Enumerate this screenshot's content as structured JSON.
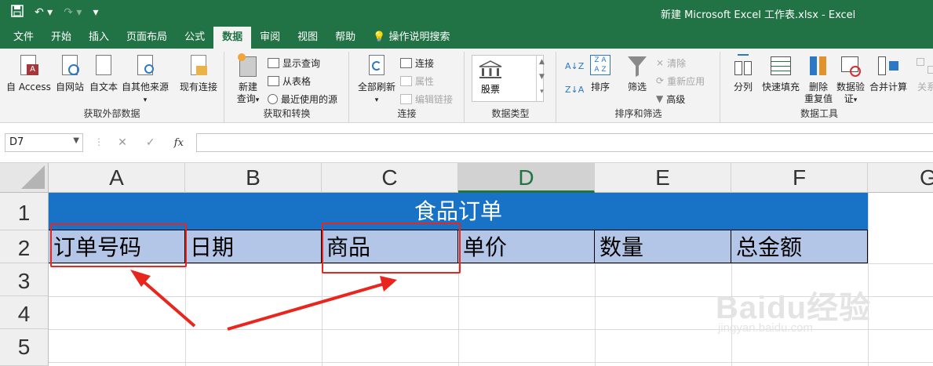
{
  "window": {
    "title": "新建 Microsoft Excel 工作表.xlsx  -  Excel"
  },
  "tabs": [
    {
      "label": "文件"
    },
    {
      "label": "开始"
    },
    {
      "label": "插入"
    },
    {
      "label": "页面布局"
    },
    {
      "label": "公式"
    },
    {
      "label": "数据"
    },
    {
      "label": "审阅"
    },
    {
      "label": "视图"
    },
    {
      "label": "帮助"
    },
    {
      "label": "操作说明搜索"
    }
  ],
  "ribbon": {
    "get_external": {
      "label": "获取外部数据",
      "buttons": [
        "自 Access",
        "自网站",
        "自文本",
        "自其他来源",
        "现有连接"
      ]
    },
    "get_transform": {
      "label": "获取和转换",
      "new_query": "新建\n查询",
      "show_query": "显示查询",
      "from_table": "从表格",
      "recent_sources": "最近使用的源"
    },
    "connections": {
      "label": "连接",
      "refresh_all": "全部刷新",
      "connections": "连接",
      "properties": "属性",
      "edit_links": "编辑链接"
    },
    "data_types": {
      "label": "数据类型",
      "stocks": "股票"
    },
    "sort_filter": {
      "label": "排序和筛选",
      "sort": "排序",
      "filter": "筛选",
      "clear": "清除",
      "reapply": "重新应用",
      "advanced": "高级"
    },
    "data_tools": {
      "label": "数据工具",
      "split": "分列",
      "flash_fill": "快速填充",
      "remove_dup": "删除\n重复值",
      "validation": "数据验\n证",
      "consolidate": "合并计算",
      "relations": "关系"
    }
  },
  "formula_bar": {
    "name_box": "D7",
    "fx": "fx",
    "value": ""
  },
  "grid": {
    "columns": [
      "A",
      "B",
      "C",
      "D",
      "E",
      "F",
      "G"
    ],
    "selected_column": "D",
    "rows": [
      "1",
      "2",
      "3",
      "4",
      "5"
    ],
    "title": "食品订单",
    "headers": [
      "订单号码",
      "日期",
      "商品",
      "单价",
      "数量",
      "总金额"
    ]
  },
  "watermark": {
    "brand": "Baidu经验",
    "url": "jingyan.baidu.com"
  },
  "colors": {
    "excel_green": "#217346",
    "title_fill": "#1873c6",
    "header_fill": "#b4c6e7",
    "annotation_red": "#e8261e"
  }
}
